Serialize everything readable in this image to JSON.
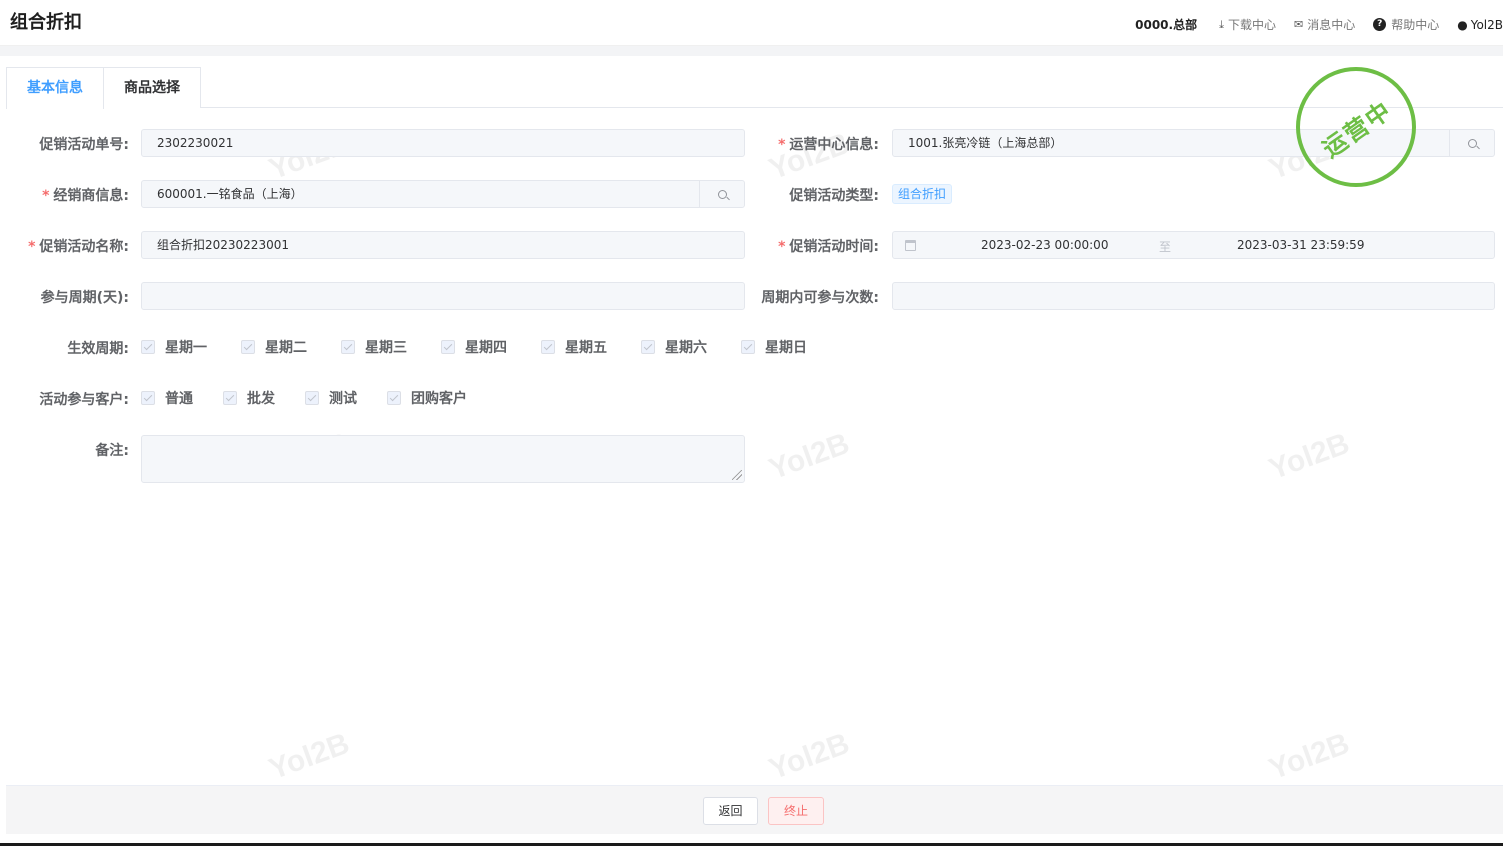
{
  "header": {
    "title": "组合折扣",
    "org": "0000.总部",
    "download": "下载中心",
    "messages": "消息中心",
    "help": "帮助中心",
    "user": "Yol2B"
  },
  "tabs": [
    {
      "label": "基本信息",
      "active": true
    },
    {
      "label": "商品选择",
      "active": false
    }
  ],
  "status_stamp": "运营中",
  "watermark_text": "Yol2B",
  "form": {
    "order_no": {
      "label": "促销活动单号:",
      "value": "2302230021"
    },
    "ops_center": {
      "label": "运营中心信息:",
      "value": "1001.张亮冷链（上海总部）"
    },
    "distributor": {
      "label": "经销商信息:",
      "value": "600001.一铭食品（上海）"
    },
    "activity_type": {
      "label": "促销活动类型:",
      "value": "组合折扣"
    },
    "activity_name": {
      "label": "促销活动名称:",
      "value": "组合折扣20230223001"
    },
    "activity_time": {
      "label": "促销活动时间:",
      "start": "2023-02-23 00:00:00",
      "separator": "至",
      "end": "2023-03-31 23:59:59"
    },
    "cycle_days": {
      "label": "参与周期(天):",
      "value": ""
    },
    "cycle_times": {
      "label": "周期内可参与次数:",
      "value": ""
    },
    "effective_days": {
      "label": "生效周期:",
      "options": [
        "星期一",
        "星期二",
        "星期三",
        "星期四",
        "星期五",
        "星期六",
        "星期日"
      ]
    },
    "customers": {
      "label": "活动参与客户:",
      "options": [
        "普通",
        "批发",
        "测试",
        "团购客户"
      ]
    },
    "remark": {
      "label": "备注:",
      "value": ""
    }
  },
  "footer": {
    "back": "返回",
    "terminate": "终止"
  },
  "colors": {
    "accent": "#409eff",
    "stamp": "#6dbe45",
    "danger": "#f56c6c"
  }
}
